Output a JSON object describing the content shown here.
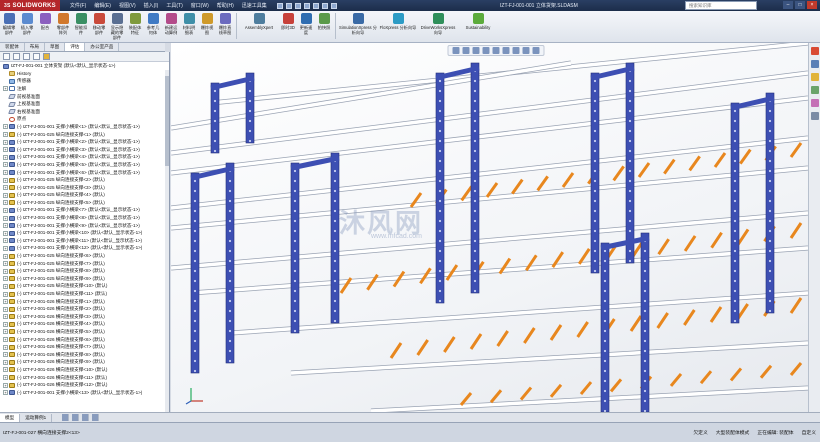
{
  "titlebar": {
    "logo": "SOLIDWORKS",
    "logo_prefix": "3S",
    "menus": [
      "文件(F)",
      "编辑(E)",
      "视图(V)",
      "插入(I)",
      "工具(T)",
      "窗口(W)",
      "帮助(H)"
    ],
    "quick_access": "迅速工具集",
    "document_title": "IZT-FJ-001-001 立体货架.SLDASM",
    "search_placeholder": "搜索知识库",
    "window_controls": [
      "–",
      "□",
      "×"
    ]
  },
  "ribbon": {
    "buttons": [
      {
        "label": "编辑零部件",
        "color": "#4a6fb5"
      },
      {
        "label": "插入零部件",
        "color": "#5b8bd0"
      },
      {
        "label": "配合",
        "color": "#8b5fbf"
      },
      {
        "label": "零部件阵列",
        "color": "#d1782c"
      },
      {
        "label": "智能扣件",
        "color": "#3a8f64"
      },
      {
        "label": "移动零部件",
        "color": "#c94a3b"
      },
      {
        "label": "显示隐藏的零部件",
        "color": "#5a6f92"
      },
      {
        "label": "装配体特征",
        "color": "#7f9a3c"
      },
      {
        "label": "参考几何体",
        "color": "#3f7ac4"
      },
      {
        "label": "新建运动算例",
        "color": "#b34b8a"
      },
      {
        "label": "材料明细表",
        "color": "#3f8fa8"
      },
      {
        "label": "爆炸视图",
        "color": "#cf9a2a"
      },
      {
        "label": "爆炸直线草图",
        "color": "#6b6bbf"
      },
      {
        "label": "AssemblyXpert",
        "color": "#4e7d9e"
      },
      {
        "label": "即时3D",
        "color": "#c7413a"
      },
      {
        "label": "更新速度",
        "color": "#2f6db1"
      },
      {
        "label": "拍快照",
        "color": "#5b9a4a"
      },
      {
        "label": "SimulationXpress 分析向导",
        "color": "#3a6aa6"
      },
      {
        "label": "FloXpress 分析向导",
        "color": "#2c9bc5"
      },
      {
        "label": "DriveWorksXpress 向导",
        "color": "#2f8f5b"
      },
      {
        "label": "Sustainability",
        "color": "#5cab3c"
      }
    ]
  },
  "command_tabs": [
    "装配体",
    "布局",
    "草图",
    "评估",
    "办公室产品"
  ],
  "active_command_tab": "评估",
  "tree": {
    "root": "IZT-FJ-001-001 立体货架 (默认<默认_显示状态-1>)",
    "items": [
      {
        "label": "History",
        "icon": "folder",
        "expand": ""
      },
      {
        "label": "传感器",
        "icon": "sens",
        "expand": ""
      },
      {
        "label": "注解",
        "icon": "note",
        "expand": "+"
      },
      {
        "label": "前视基准面",
        "icon": "plane",
        "expand": ""
      },
      {
        "label": "上视基准面",
        "icon": "plane",
        "expand": ""
      },
      {
        "label": "右视基准面",
        "icon": "plane",
        "expand": ""
      },
      {
        "label": "原点",
        "icon": "origin",
        "expand": ""
      },
      {
        "label": "(-) IZT-FJ-001-001 支撑小横梁<1> (默认<默认_显示状态-1>)",
        "icon": "asm",
        "expand": "+"
      },
      {
        "label": "(-) IZT-FJ-001-025 纵向连接支撑<1> (默认)",
        "icon": "part",
        "expand": "+"
      },
      {
        "label": "(-) IZT-FJ-001-001 支撑小横梁<2> (默认<默认_显示状态-1>)",
        "icon": "asm",
        "expand": "+"
      },
      {
        "label": "(-) IZT-FJ-001-001 支撑小横梁<3> (默认<默认_显示状态-1>)",
        "icon": "asm",
        "expand": "+"
      },
      {
        "label": "(-) IZT-FJ-001-001 支撑小横梁<4> (默认<默认_显示状态-1>)",
        "icon": "asm",
        "expand": "+"
      },
      {
        "label": "(-) IZT-FJ-001-001 支撑小横梁<5> (默认<默认_显示状态-1>)",
        "icon": "asm",
        "expand": "+"
      },
      {
        "label": "(-) IZT-FJ-001-001 支撑小横梁<6> (默认<默认_显示状态-1>)",
        "icon": "asm",
        "expand": "+"
      },
      {
        "label": "(-) IZT-FJ-001-025 纵向连接支撑<2> (默认)",
        "icon": "part",
        "expand": "+"
      },
      {
        "label": "(-) IZT-FJ-001-025 纵向连接支撑<3> (默认)",
        "icon": "part",
        "expand": "+"
      },
      {
        "label": "(-) IZT-FJ-001-025 纵向连接支撑<4> (默认)",
        "icon": "part",
        "expand": "+"
      },
      {
        "label": "(-) IZT-FJ-001-025 纵向连接支撑<5> (默认)",
        "icon": "part",
        "expand": "+"
      },
      {
        "label": "(-) IZT-FJ-001-001 支撑小横梁<7> (默认<默认_显示状态-1>)",
        "icon": "asm",
        "expand": "+"
      },
      {
        "label": "(-) IZT-FJ-001-001 支撑小横梁<8> (默认<默认_显示状态-1>)",
        "icon": "asm",
        "expand": "+"
      },
      {
        "label": "(-) IZT-FJ-001-001 支撑小横梁<9> (默认<默认_显示状态-1>)",
        "icon": "asm",
        "expand": "+"
      },
      {
        "label": "(-) IZT-FJ-001-001 支撑小横梁<10> (默认<默认_显示状态-1>)",
        "icon": "asm",
        "expand": "+"
      },
      {
        "label": "(-) IZT-FJ-001-001 支撑小横梁<11> (默认<默认_显示状态-1>)",
        "icon": "asm",
        "expand": "+"
      },
      {
        "label": "(-) IZT-FJ-001-001 支撑小横梁<12> (默认<默认_显示状态-1>)",
        "icon": "asm",
        "expand": "+"
      },
      {
        "label": "(-) IZT-FJ-001-025 纵向连接支撑<6> (默认)",
        "icon": "part",
        "expand": "+"
      },
      {
        "label": "(-) IZT-FJ-001-025 纵向连接支撑<7> (默认)",
        "icon": "part",
        "expand": "+"
      },
      {
        "label": "(-) IZT-FJ-001-025 纵向连接支撑<8> (默认)",
        "icon": "part",
        "expand": "+"
      },
      {
        "label": "(-) IZT-FJ-001-025 纵向连接支撑<9> (默认)",
        "icon": "part",
        "expand": "+"
      },
      {
        "label": "(-) IZT-FJ-001-025 纵向连接支撑<10> (默认)",
        "icon": "part",
        "expand": "+"
      },
      {
        "label": "(-) IZT-FJ-001-025 纵向连接支撑<11> (默认)",
        "icon": "part",
        "expand": "+"
      },
      {
        "label": "(-) IZT-FJ-001-026 横向连接支撑<1> (默认)",
        "icon": "part",
        "expand": "+"
      },
      {
        "label": "(-) IZT-FJ-001-026 横向连接支撑<2> (默认)",
        "icon": "part",
        "expand": "+"
      },
      {
        "label": "(-) IZT-FJ-001-026 横向连接支撑<3> (默认)",
        "icon": "part",
        "expand": "+"
      },
      {
        "label": "(-) IZT-FJ-001-026 横向连接支撑<4> (默认)",
        "icon": "part",
        "expand": "+"
      },
      {
        "label": "(-) IZT-FJ-001-026 横向连接支撑<5> (默认)",
        "icon": "part",
        "expand": "+"
      },
      {
        "label": "(-) IZT-FJ-001-026 横向连接支撑<6> (默认)",
        "icon": "part",
        "expand": "+"
      },
      {
        "label": "(-) IZT-FJ-001-026 横向连接支撑<7> (默认)",
        "icon": "part",
        "expand": "+"
      },
      {
        "label": "(-) IZT-FJ-001-026 横向连接支撑<8> (默认)",
        "icon": "part",
        "expand": "+"
      },
      {
        "label": "(-) IZT-FJ-001-026 横向连接支撑<9> (默认)",
        "icon": "part",
        "expand": "+"
      },
      {
        "label": "(-) IZT-FJ-001-026 横向连接支撑<10> (默认)",
        "icon": "part",
        "expand": "+"
      },
      {
        "label": "(-) IZT-FJ-001-026 横向连接支撑<11> (默认)",
        "icon": "part",
        "expand": "+"
      },
      {
        "label": "(-) IZT-FJ-001-026 横向连接支撑<12> (默认)",
        "icon": "part",
        "expand": "+"
      },
      {
        "label": "(-) IZT-FJ-001-001 支撑小横梁<13> (默认<默认_显示状态-1>)",
        "icon": "asm",
        "expand": "+"
      }
    ]
  },
  "viewport": {
    "watermark": "沐风网",
    "watermark_sub": "www.mfcad.com",
    "frame_color": "#3d4fb3",
    "rail_color": "#ffffff",
    "roller_color": "#e8871e"
  },
  "bottom_tabs": [
    "模型",
    "运动算例1"
  ],
  "status": {
    "left": "IZT-FJ-001-027 横向连接支撑2<13>",
    "right": [
      "欠定义",
      "大型装配体模式",
      "正在编辑: 装配体",
      "自定义"
    ]
  }
}
